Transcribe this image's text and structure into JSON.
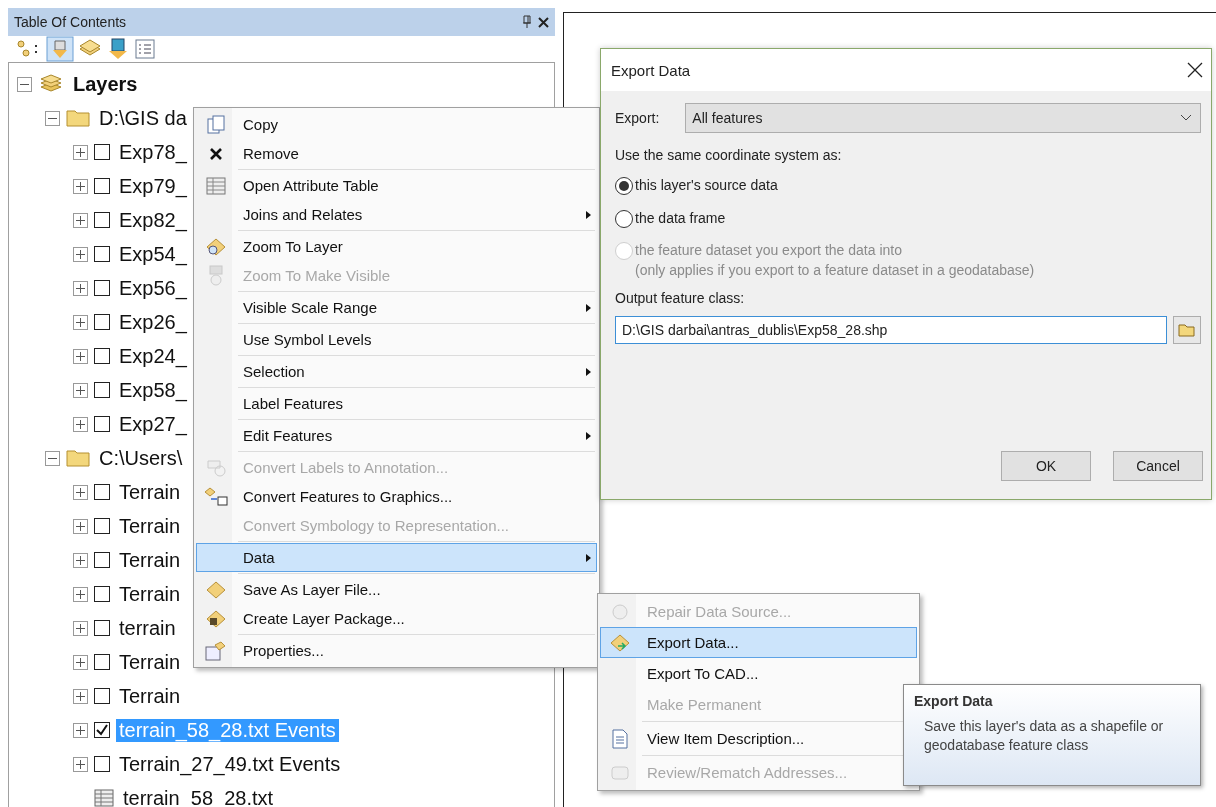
{
  "toc": {
    "title": "Table Of Contents",
    "tree": [
      {
        "kind": "frame",
        "label": "Layers",
        "expanded": true,
        "children": [
          {
            "kind": "folder",
            "label": "D:\\GIS da",
            "expanded": true,
            "children": [
              {
                "kind": "layer",
                "label": "Exp78_",
                "expanded": false,
                "checked": false,
                "selected": false
              },
              {
                "kind": "layer",
                "label": "Exp79_",
                "expanded": false,
                "checked": false,
                "selected": false
              },
              {
                "kind": "layer",
                "label": "Exp82_",
                "expanded": false,
                "checked": false,
                "selected": false
              },
              {
                "kind": "layer",
                "label": "Exp54_",
                "expanded": false,
                "checked": false,
                "selected": false
              },
              {
                "kind": "layer",
                "label": "Exp56_",
                "expanded": false,
                "checked": false,
                "selected": false
              },
              {
                "kind": "layer",
                "label": "Exp26_",
                "expanded": false,
                "checked": false,
                "selected": false
              },
              {
                "kind": "layer",
                "label": "Exp24_",
                "expanded": false,
                "checked": false,
                "selected": false
              },
              {
                "kind": "layer",
                "label": "Exp58_",
                "expanded": false,
                "checked": false,
                "selected": false
              },
              {
                "kind": "layer",
                "label": "Exp27_",
                "expanded": false,
                "checked": false,
                "selected": false
              }
            ]
          },
          {
            "kind": "folder",
            "label": "C:\\Users\\",
            "expanded": true,
            "children": [
              {
                "kind": "layer",
                "label": "Terrain",
                "expanded": false,
                "checked": false,
                "selected": false
              },
              {
                "kind": "layer",
                "label": "Terrain",
                "expanded": false,
                "checked": false,
                "selected": false
              },
              {
                "kind": "layer",
                "label": "Terrain",
                "expanded": false,
                "checked": false,
                "selected": false
              },
              {
                "kind": "layer",
                "label": "Terrain",
                "expanded": false,
                "checked": false,
                "selected": false
              },
              {
                "kind": "layer",
                "label": "terrain",
                "expanded": false,
                "checked": false,
                "selected": false
              },
              {
                "kind": "layer",
                "label": "Terrain",
                "expanded": false,
                "checked": false,
                "selected": false
              },
              {
                "kind": "layer",
                "label": "Terrain",
                "expanded": false,
                "checked": false,
                "selected": false
              },
              {
                "kind": "layer",
                "label": "terrain_58_28.txt Events",
                "expanded": false,
                "checked": true,
                "selected": true
              },
              {
                "kind": "layer",
                "label": "Terrain_27_49.txt Events",
                "expanded": false,
                "checked": false,
                "selected": false
              },
              {
                "kind": "table",
                "label": "terrain_58_28.txt"
              }
            ]
          }
        ]
      }
    ]
  },
  "context_menu": {
    "sections": [
      [
        {
          "label": "Copy",
          "disabled": false,
          "submenu": false,
          "selected": false
        },
        {
          "label": "Remove",
          "disabled": false,
          "submenu": false,
          "selected": false
        }
      ],
      [
        {
          "label": "Open Attribute Table",
          "disabled": false,
          "submenu": false,
          "selected": false
        },
        {
          "label": "Joins and Relates",
          "disabled": false,
          "submenu": true,
          "selected": false
        }
      ],
      [
        {
          "label": "Zoom To Layer",
          "disabled": false,
          "submenu": false,
          "selected": false
        },
        {
          "label": "Zoom To Make Visible",
          "disabled": true,
          "submenu": false,
          "selected": false
        }
      ],
      [
        {
          "label": "Visible Scale Range",
          "disabled": false,
          "submenu": true,
          "selected": false
        }
      ],
      [
        {
          "label": "Use Symbol Levels",
          "disabled": false,
          "submenu": false,
          "selected": false
        }
      ],
      [
        {
          "label": "Selection",
          "disabled": false,
          "submenu": true,
          "selected": false
        }
      ],
      [
        {
          "label": "Label Features",
          "disabled": false,
          "submenu": false,
          "selected": false
        }
      ],
      [
        {
          "label": "Edit Features",
          "disabled": false,
          "submenu": true,
          "selected": false
        }
      ],
      [
        {
          "label": "Convert Labels to Annotation...",
          "disabled": true,
          "submenu": false,
          "selected": false
        },
        {
          "label": "Convert Features to Graphics...",
          "disabled": false,
          "submenu": false,
          "selected": false
        },
        {
          "label": "Convert Symbology to Representation...",
          "disabled": true,
          "submenu": false,
          "selected": false
        }
      ],
      [
        {
          "label": "Data",
          "disabled": false,
          "submenu": true,
          "selected": true
        }
      ],
      [
        {
          "label": "Save As Layer File...",
          "disabled": false,
          "submenu": false,
          "selected": false
        },
        {
          "label": "Create Layer Package...",
          "disabled": false,
          "submenu": false,
          "selected": false
        }
      ],
      [
        {
          "label": "Properties...",
          "disabled": false,
          "submenu": false,
          "selected": false
        }
      ]
    ]
  },
  "data_submenu": {
    "sections": [
      [
        {
          "label": "Repair Data Source...",
          "disabled": true,
          "selected": false
        },
        {
          "label": "Export Data...",
          "disabled": false,
          "selected": true
        },
        {
          "label": "Export To CAD...",
          "disabled": false,
          "selected": false
        },
        {
          "label": "Make Permanent",
          "disabled": true,
          "selected": false
        }
      ],
      [
        {
          "label": "View Item Description...",
          "disabled": false,
          "selected": false
        }
      ],
      [
        {
          "label": "Review/Rematch Addresses...",
          "disabled": true,
          "selected": false
        }
      ]
    ]
  },
  "tooltip": {
    "title": "Export Data",
    "text": "Save this layer's data as a shapefile or geodatabase feature class"
  },
  "dialog": {
    "title": "Export Data",
    "export_label": "Export:",
    "export_value": "All features",
    "coordinate_label": "Use the same coordinate system as:",
    "options": [
      {
        "label": "this layer's source data",
        "selected": true,
        "disabled": false
      },
      {
        "label": "the data frame",
        "selected": false,
        "disabled": false
      },
      {
        "label": "the feature dataset you export the data into",
        "note": "(only applies if you export to a feature dataset in a geodatabase)",
        "selected": false,
        "disabled": true
      }
    ],
    "output_label": "Output feature class:",
    "output_value": "D:\\GIS darbai\\antras_dublis\\Exp58_28.shp",
    "buttons": [
      "OK",
      "Cancel"
    ]
  }
}
